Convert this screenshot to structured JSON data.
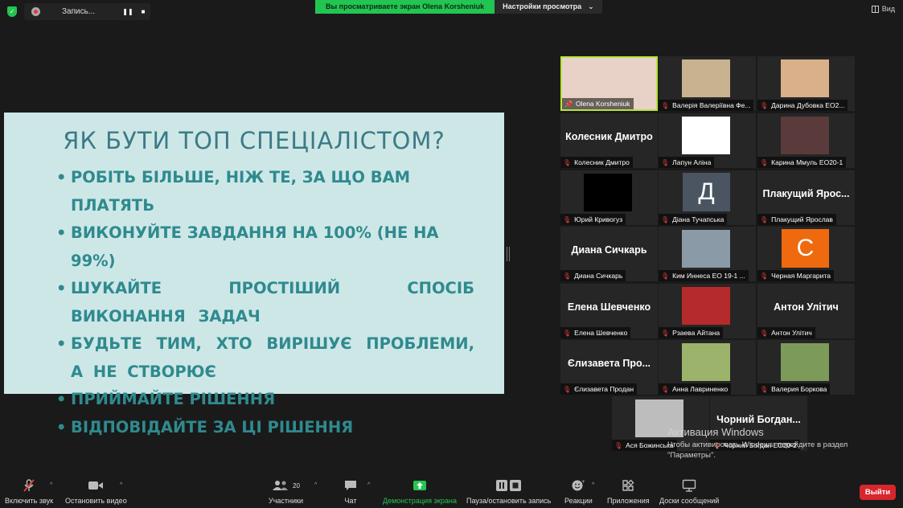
{
  "top_bar": {
    "recording_label": "Запись...",
    "viewing_banner": "Вы просматриваете экран Olena Korsheniuk",
    "view_options_label": "Настройки просмотра",
    "view_label": "Вид"
  },
  "slide": {
    "title": "ЯК БУТИ ТОП СПЕЦІАЛІСТОМ?",
    "bullets": [
      "РОБІТЬ БІЛЬШЕ, НІЖ ТЕ, ЗА ЩО ВАМ ПЛАТЯТЬ",
      "ВИКОНУЙТЕ ЗАВДАННЯ НА 100% (НЕ НА 99%)",
      "ШУКАЙТЕ ПРОСТІШИЙ СПОСІБ ВИКОНАННЯ ЗАДАЧ",
      "БУДЬТЕ ТИМ, ХТО ВИРІШУЄ ПРОБЛЕМИ, А НЕ СТВОРЮЄ",
      "ПРИЙМАЙТЕ РІШЕННЯ",
      "ВІДПОВІДАЙТЕ ЗА ЦІ РІШЕННЯ"
    ]
  },
  "participants": [
    {
      "caption": "Olena Korsheniuk",
      "big_name": "",
      "kind": "photo",
      "color": "#e8d2c8",
      "active": true
    },
    {
      "caption": "Валерія Валеріївна Фе...",
      "big_name": "",
      "kind": "photo",
      "color": "#c9b28f",
      "active": false
    },
    {
      "caption": "Дарина Дубовка ЕО2...",
      "big_name": "",
      "kind": "photo",
      "color": "#d9b089",
      "active": false
    },
    {
      "caption": "Колесник Дмитро",
      "big_name": "Колесник Дмитро",
      "kind": "name",
      "color": "",
      "active": false
    },
    {
      "caption": "Лапун Аліна",
      "big_name": "",
      "kind": "photo",
      "color": "#ffffff",
      "active": false
    },
    {
      "caption": "Карина Ммуль ЕО20-1",
      "big_name": "",
      "kind": "photo",
      "color": "#5a3a3a",
      "active": false
    },
    {
      "caption": "Юрий Кривогуз",
      "big_name": "",
      "kind": "photo",
      "color": "#000000",
      "active": false
    },
    {
      "caption": "Діана Тучапська",
      "big_name": "",
      "kind": "letter",
      "letter": "Д",
      "color": "#4a5561",
      "active": false
    },
    {
      "caption": "Плакущий Ярослав",
      "big_name": "Плакущий Ярос...",
      "kind": "name",
      "color": "",
      "active": false
    },
    {
      "caption": "Диана Сичкарь",
      "big_name": "Диана Сичкарь",
      "kind": "name",
      "color": "",
      "active": false
    },
    {
      "caption": "Ким Иннеса ЕО 19-1 ...",
      "big_name": "",
      "kind": "photo",
      "color": "#8a9aa6",
      "active": false
    },
    {
      "caption": "Черная Маргарита",
      "big_name": "",
      "kind": "letter",
      "letter": "С",
      "color": "#ef6a0f",
      "active": false
    },
    {
      "caption": "Елена Шевченко",
      "big_name": "Елена Шевченко",
      "kind": "name",
      "color": "",
      "active": false
    },
    {
      "caption": "Рзаева Айтана",
      "big_name": "",
      "kind": "photo",
      "color": "#b52a2a",
      "active": false
    },
    {
      "caption": "Антон Улітич",
      "big_name": "Антон Улітич",
      "kind": "name",
      "color": "",
      "active": false
    },
    {
      "caption": "Єлизавета Продан",
      "big_name": "Єлизавета Про...",
      "kind": "name",
      "color": "",
      "active": false
    },
    {
      "caption": "Анна Лавриненко",
      "big_name": "",
      "kind": "photo",
      "color": "#9bb36a",
      "active": false
    },
    {
      "caption": "Валерия Боркова",
      "big_name": "",
      "kind": "photo",
      "color": "#7c9b5a",
      "active": false
    },
    {
      "caption": "Ася Божинська",
      "big_name": "",
      "kind": "photo",
      "color": "#bdbdbd",
      "active": false
    },
    {
      "caption": "Чорний Богдан ЕО20-2",
      "big_name": "Чорний Богдан...",
      "kind": "name",
      "color": "",
      "active": false
    }
  ],
  "watermark": {
    "title": "Активация Windows",
    "line1": "Чтобы активировать Windows, перейдите в раздел",
    "line2": "\"Параметры\"."
  },
  "toolbar": {
    "mute_label": "Включить звук",
    "video_label": "Остановить видео",
    "participants_label": "Участники",
    "participants_count": "20",
    "chat_label": "Чат",
    "share_label": "Демонстрация экрана",
    "record_label": "Пауза/остановить запись",
    "reactions_label": "Реакции",
    "apps_label": "Приложения",
    "whiteboard_label": "Доски сообщений",
    "leave_label": "Выйти"
  }
}
